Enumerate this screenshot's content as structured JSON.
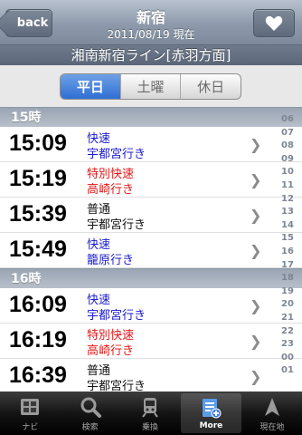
{
  "nav": {
    "back_label": "back",
    "title": "新宿",
    "subtitle": "2011/08/19 現在"
  },
  "line_title": "湘南新宿ライン[赤羽方面]",
  "segments": [
    "平日",
    "土曜",
    "休日"
  ],
  "selected_segment": "平日",
  "sections": [
    {
      "header": "15時",
      "rows": [
        {
          "time": "15:09",
          "type": "快速",
          "dest": "宇都宮行き",
          "color": "blue"
        },
        {
          "time": "15:19",
          "type": "特別快速",
          "dest": "高崎行き",
          "color": "red"
        },
        {
          "time": "15:39",
          "type": "普通",
          "dest": "宇都宮行き",
          "color": "black"
        },
        {
          "time": "15:49",
          "type": "快速",
          "dest": "籠原行き",
          "color": "blue"
        }
      ]
    },
    {
      "header": "16時",
      "rows": [
        {
          "time": "16:09",
          "type": "快速",
          "dest": "宇都宮行き",
          "color": "blue"
        },
        {
          "time": "16:19",
          "type": "特別快速",
          "dest": "高崎行き",
          "color": "red"
        },
        {
          "time": "16:39",
          "type": "普通",
          "dest": "宇都宮行き",
          "color": "black"
        }
      ]
    }
  ],
  "hour_index": [
    "06",
    "07",
    "08",
    "09",
    "10",
    "11",
    "12",
    "13",
    "14",
    "15",
    "16",
    "17",
    "18",
    "19",
    "20",
    "21",
    "22",
    "23",
    "00",
    "01"
  ],
  "tabs": [
    {
      "label": "ナビ",
      "icon": "navi-icon"
    },
    {
      "label": "検索",
      "icon": "search-icon"
    },
    {
      "label": "乗換",
      "icon": "train-icon"
    },
    {
      "label": "More",
      "icon": "more-icon"
    },
    {
      "label": "現在地",
      "icon": "location-arrow-icon"
    }
  ],
  "active_tab": "More",
  "colors": {
    "blue": "#1a1ad0",
    "red": "#e01818",
    "black": "#111111",
    "accent": "#2f6fd3"
  }
}
